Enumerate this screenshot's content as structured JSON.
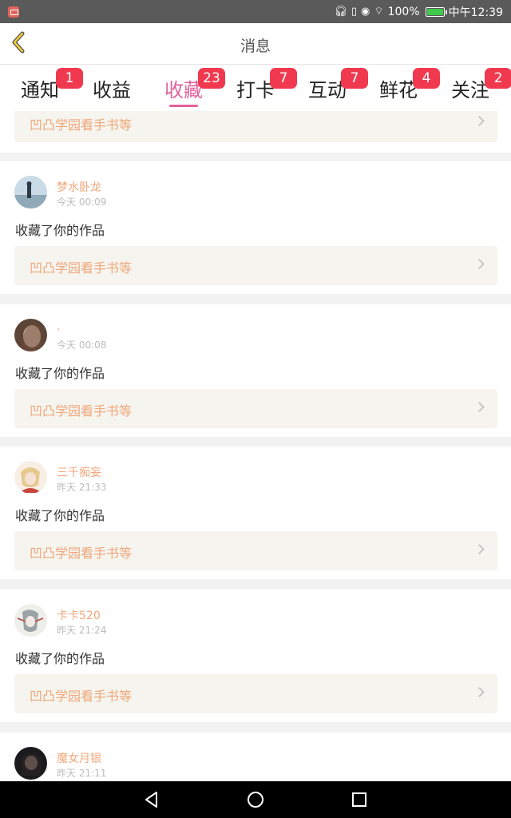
{
  "status_bar": {
    "battery": "100%",
    "time": "中午12:39"
  },
  "header": {
    "title": "消息"
  },
  "tabs": [
    {
      "label": "通知",
      "badge": "1",
      "active": false
    },
    {
      "label": "收益",
      "badge": "",
      "active": false
    },
    {
      "label": "收藏",
      "badge": "23",
      "active": true
    },
    {
      "label": "打卡",
      "badge": "7",
      "active": false
    },
    {
      "label": "互动",
      "badge": "7",
      "active": false
    },
    {
      "label": "鲜花",
      "badge": "4",
      "active": false
    },
    {
      "label": "关注",
      "badge": "2",
      "active": false
    }
  ],
  "partial_card": {
    "link_text": "凹凸学园看手书等"
  },
  "items": [
    {
      "user": "梦水卧龙",
      "time": "今天 00:09",
      "action": "收藏了你的作品",
      "link_text": "凹凸学园看手书等"
    },
    {
      "user": ".",
      "time": "今天 00:08",
      "action": "收藏了你的作品",
      "link_text": "凹凸学园看手书等"
    },
    {
      "user": "三千痴妄",
      "time": "昨天 21:33",
      "action": "收藏了你的作品",
      "link_text": "凹凸学园看手书等"
    },
    {
      "user": "卡卡520",
      "time": "昨天 21:24",
      "action": "收藏了你的作品",
      "link_text": "凹凸学园看手书等"
    },
    {
      "user": "魔女月银",
      "time": "昨天 21:11"
    }
  ],
  "colors": {
    "accent": "#e2619c",
    "badge": "#f0394f",
    "username": "#f0a77a",
    "link_box": "#f5f4ee"
  }
}
